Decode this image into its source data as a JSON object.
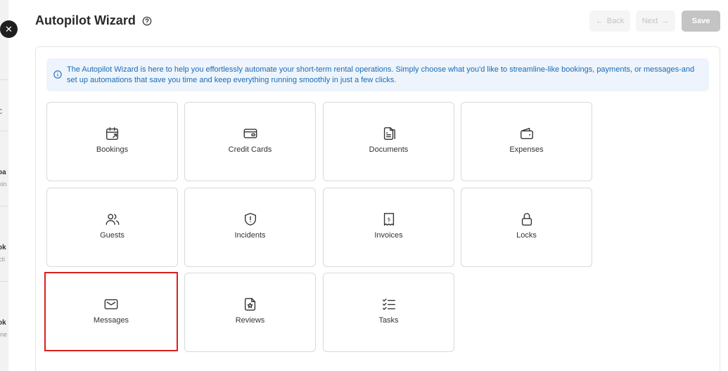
{
  "background": {
    "fragments": [
      "C",
      "oa",
      "kin",
      "ok",
      "cti",
      "ok",
      "ine"
    ]
  },
  "header": {
    "title": "Autopilot Wizard",
    "back_label": "Back",
    "next_label": "Next",
    "save_label": "Save"
  },
  "info_banner": {
    "text": "The Autopilot Wizard is here to help you effortlessly automate your short-term rental operations. Simply choose what you'd like to streamline-like bookings, payments, or messages-and set up automations that save you time and keep everything running smoothly in just a few clicks."
  },
  "cards": [
    {
      "label": "Bookings",
      "icon": "calendar-arrow-icon"
    },
    {
      "label": "Credit Cards",
      "icon": "credit-card-icon"
    },
    {
      "label": "Documents",
      "icon": "documents-icon"
    },
    {
      "label": "Expenses",
      "icon": "wallet-icon"
    },
    {
      "label": "Guests",
      "icon": "users-icon"
    },
    {
      "label": "Incidents",
      "icon": "shield-alert-icon"
    },
    {
      "label": "Invoices",
      "icon": "receipt-dollar-icon"
    },
    {
      "label": "Locks",
      "icon": "lock-icon"
    },
    {
      "label": "Messages",
      "icon": "mail-icon",
      "selected": true
    },
    {
      "label": "Reviews",
      "icon": "star-file-icon"
    },
    {
      "label": "Tasks",
      "icon": "checklist-icon"
    }
  ],
  "colors": {
    "accent_text": "#1c6bb5",
    "banner_bg": "#edf4fb",
    "selected_border": "#d92020",
    "save_disabled": "#c4c4c4"
  }
}
